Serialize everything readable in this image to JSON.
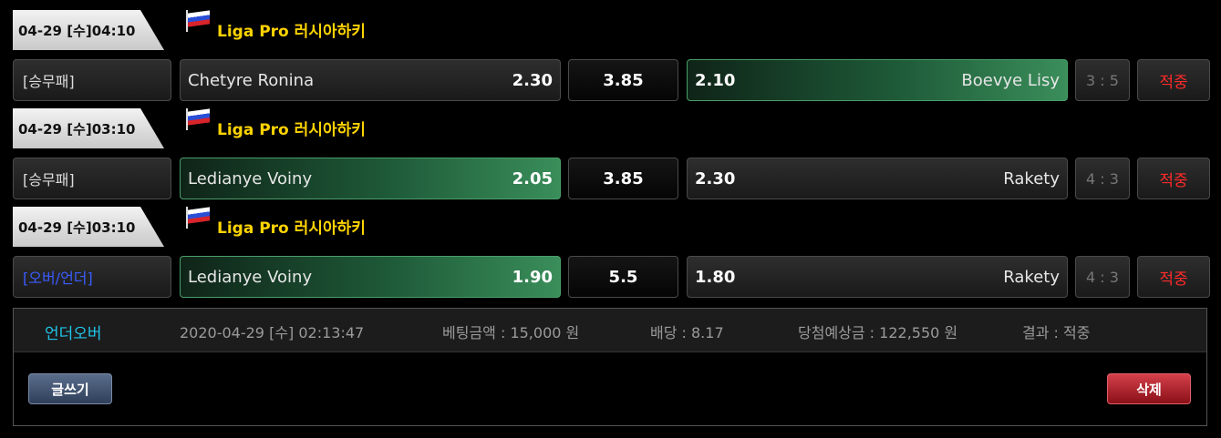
{
  "matches": [
    {
      "date": "04-29 [수]04:10",
      "league": "Liga Pro 러시아하키",
      "bet_type": "[승무패]",
      "home_team": "Chetyre Ronina",
      "home_odds": "2.30",
      "draw_odds": "3.85",
      "away_odds": "2.10",
      "away_team": "Boevye Lisy",
      "score": "3 : 5",
      "result": "적중",
      "selected": "away"
    },
    {
      "date": "04-29 [수]03:10",
      "league": "Liga Pro 러시아하키",
      "bet_type": "[승무패]",
      "home_team": "Ledianye Voiny",
      "home_odds": "2.05",
      "draw_odds": "3.85",
      "away_odds": "2.30",
      "away_team": "Rakety",
      "score": "4 : 3",
      "result": "적중",
      "selected": "home"
    },
    {
      "date": "04-29 [수]03:10",
      "league": "Liga Pro 러시아하키",
      "bet_type": "[오버/언더]",
      "home_team": "Ledianye Voiny",
      "home_odds": "1.90",
      "draw_odds": "5.5",
      "away_odds": "1.80",
      "away_team": "Rakety",
      "score": "4 : 3",
      "result": "적중",
      "selected": "home"
    }
  ],
  "summary": {
    "type": "언더오버",
    "datetime": "2020-04-29 [수] 02:13:47",
    "bet_amount": "베팅금액 : 15,000 원",
    "odds": "배당 : 8.17",
    "expected_win": "당첨예상금 : 122,550 원",
    "result": "결과 : 적중"
  },
  "buttons": {
    "write": "글쓰기",
    "delete": "삭제"
  },
  "colors": {
    "league": "#ffd400",
    "result": "#ff2a2a",
    "summary_type": "#21c4e8",
    "selected_green": "#3a8e5a"
  }
}
